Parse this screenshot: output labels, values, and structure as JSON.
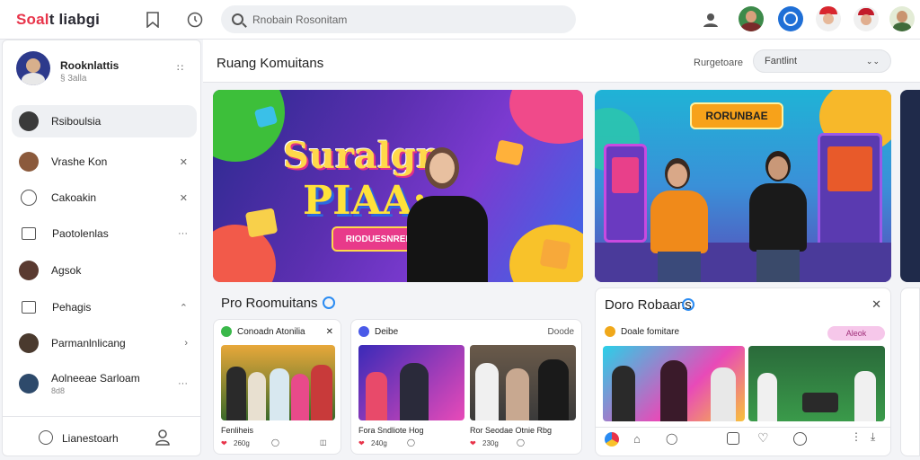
{
  "header": {
    "logo_part1": "Soal",
    "logo_part2": "t liabgi",
    "search_placeholder": "Rnobain Rosonitam"
  },
  "sidebar": {
    "profile": {
      "name": "Rooknlattis",
      "meta": "§ 3alla"
    },
    "items": [
      {
        "label": "Rsiboulsia",
        "tail": ""
      },
      {
        "label": "Vrashe Kon",
        "tail": "✕"
      },
      {
        "label": "Cakoakin",
        "tail": "✕"
      },
      {
        "label": "Paotolenlas",
        "tail": "···"
      },
      {
        "label": "Agsok",
        "tail": ""
      },
      {
        "label": "Pehagis",
        "tail": "⌃"
      },
      {
        "label": "Parmanlnlicang",
        "tail": "›"
      },
      {
        "label": "Aolneeae Sarloam",
        "tail": "···",
        "sub": "8d8"
      }
    ],
    "footer_label": "Lianestoarh"
  },
  "main": {
    "title": "Ruang Komuitans",
    "sort_label": "Rurgetoare",
    "filter_value": "Fantlint"
  },
  "hero": {
    "left_title1": "Suralgm",
    "left_title2": "PIAA:",
    "left_banner": "RIODUESNREEBEN",
    "right_sign": "RORUNBAE"
  },
  "section_left": {
    "title": "Pro Roomuitans",
    "cards": [
      {
        "header": "Conoadn Atonilia",
        "caption": "Fenliheis",
        "meta": "260g"
      },
      {
        "header": "Deibe",
        "header_tail": "Doode",
        "caption": "Fora Sndliote Hog",
        "meta": "240g"
      },
      {
        "header": "",
        "caption": "Ror Seodae Otnie Rbg",
        "meta": "230g"
      }
    ]
  },
  "section_right": {
    "title": "Doro Robaans",
    "header": "Doale fomitare",
    "pill": "Aleok"
  },
  "colors": {
    "accent": "#e8344a",
    "verified": "#2a8bf2",
    "pill_bg": "#f6c7ea"
  }
}
